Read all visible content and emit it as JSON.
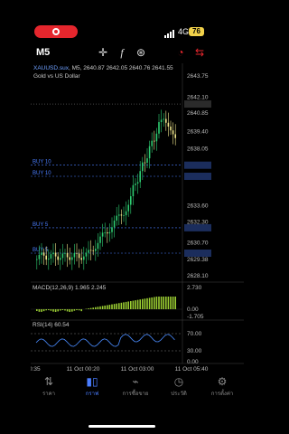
{
  "status_bar": {
    "network": "4G",
    "battery": "76"
  },
  "toolbar": {
    "timeframe": "M5"
  },
  "chart_header": {
    "symbol": "XAUUSD.sux",
    "ohlc": ", M5, 2640.87 2642.05 2640.76 2641.55",
    "description": "Gold vs US Dollar"
  },
  "price_axis": {
    "ticks": [
      "2643.75",
      "2642.10",
      "2640.85",
      "2639.40",
      "2638.05",
      "2636.76",
      "2635.89",
      "2633.60",
      "2632.30",
      "2631.86",
      "2630.70",
      "2629.87",
      "2629.38",
      "2628.10"
    ],
    "current_price": "2641.55"
  },
  "order_lines": [
    {
      "label": "BUY 10",
      "price": "2636.76"
    },
    {
      "label": "BUY 10",
      "price": "2635.89"
    },
    {
      "label": "BUY 5",
      "price": "2631.86"
    },
    {
      "label": "BUY 5",
      "price": "2629.87"
    }
  ],
  "macd": {
    "label": "MACD(12,26,9) 1.965 2.245",
    "ticks": [
      "2.730",
      "0.00",
      "-1.705"
    ]
  },
  "rsi": {
    "label": "RSI(14) 60.54",
    "ticks": [
      "70.00",
      "30.00",
      "0.00"
    ]
  },
  "time_axis": [
    "10 Oct 20:35",
    "11 Oct 00:20",
    "11 Oct 03:00",
    "11 Oct 05:40"
  ],
  "bottom_nav": [
    {
      "label": "ราคา",
      "icon": "swap-icon"
    },
    {
      "label": "กราฟ",
      "icon": "candles-icon"
    },
    {
      "label": "การซื้อขาย",
      "icon": "trend-icon"
    },
    {
      "label": "ประวัติ",
      "icon": "history-icon"
    },
    {
      "label": "การตั้งค่า",
      "icon": "gear-icon"
    }
  ],
  "colors": {
    "bull": "#2ecc71",
    "bear": "#f0e68c",
    "order": "#4a7dff",
    "accent": "#4a7dff"
  }
}
